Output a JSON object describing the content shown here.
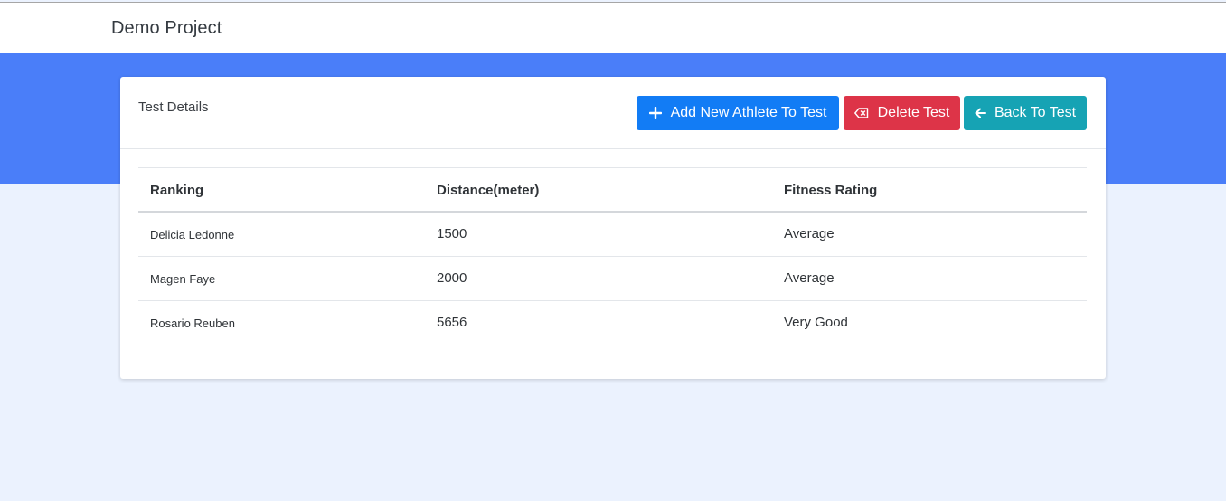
{
  "navbar": {
    "brand": "Demo Project"
  },
  "card": {
    "title": "Test Details",
    "buttons": {
      "add": "Add New Athlete To Test",
      "delete": "Delete Test",
      "back": "Back To Test"
    }
  },
  "table": {
    "headers": [
      "Ranking",
      "Distance(meter)",
      "Fitness Rating"
    ],
    "rows": [
      {
        "name": "Delicia Ledonne",
        "distance": "1500",
        "rating": "Average"
      },
      {
        "name": "Magen Faye",
        "distance": "2000",
        "rating": "Average"
      },
      {
        "name": "Rosario Reuben",
        "distance": "5656",
        "rating": "Very Good"
      }
    ]
  },
  "colors": {
    "hero": "#4a7ef9",
    "page_bg": "#ebf2fe",
    "add_button": "#127cf5",
    "delete_button": "#dd3448",
    "back_button": "#16a3b4"
  },
  "icons": {
    "add": "plus-icon",
    "delete": "backspace-icon",
    "back": "arrow-left-icon"
  }
}
